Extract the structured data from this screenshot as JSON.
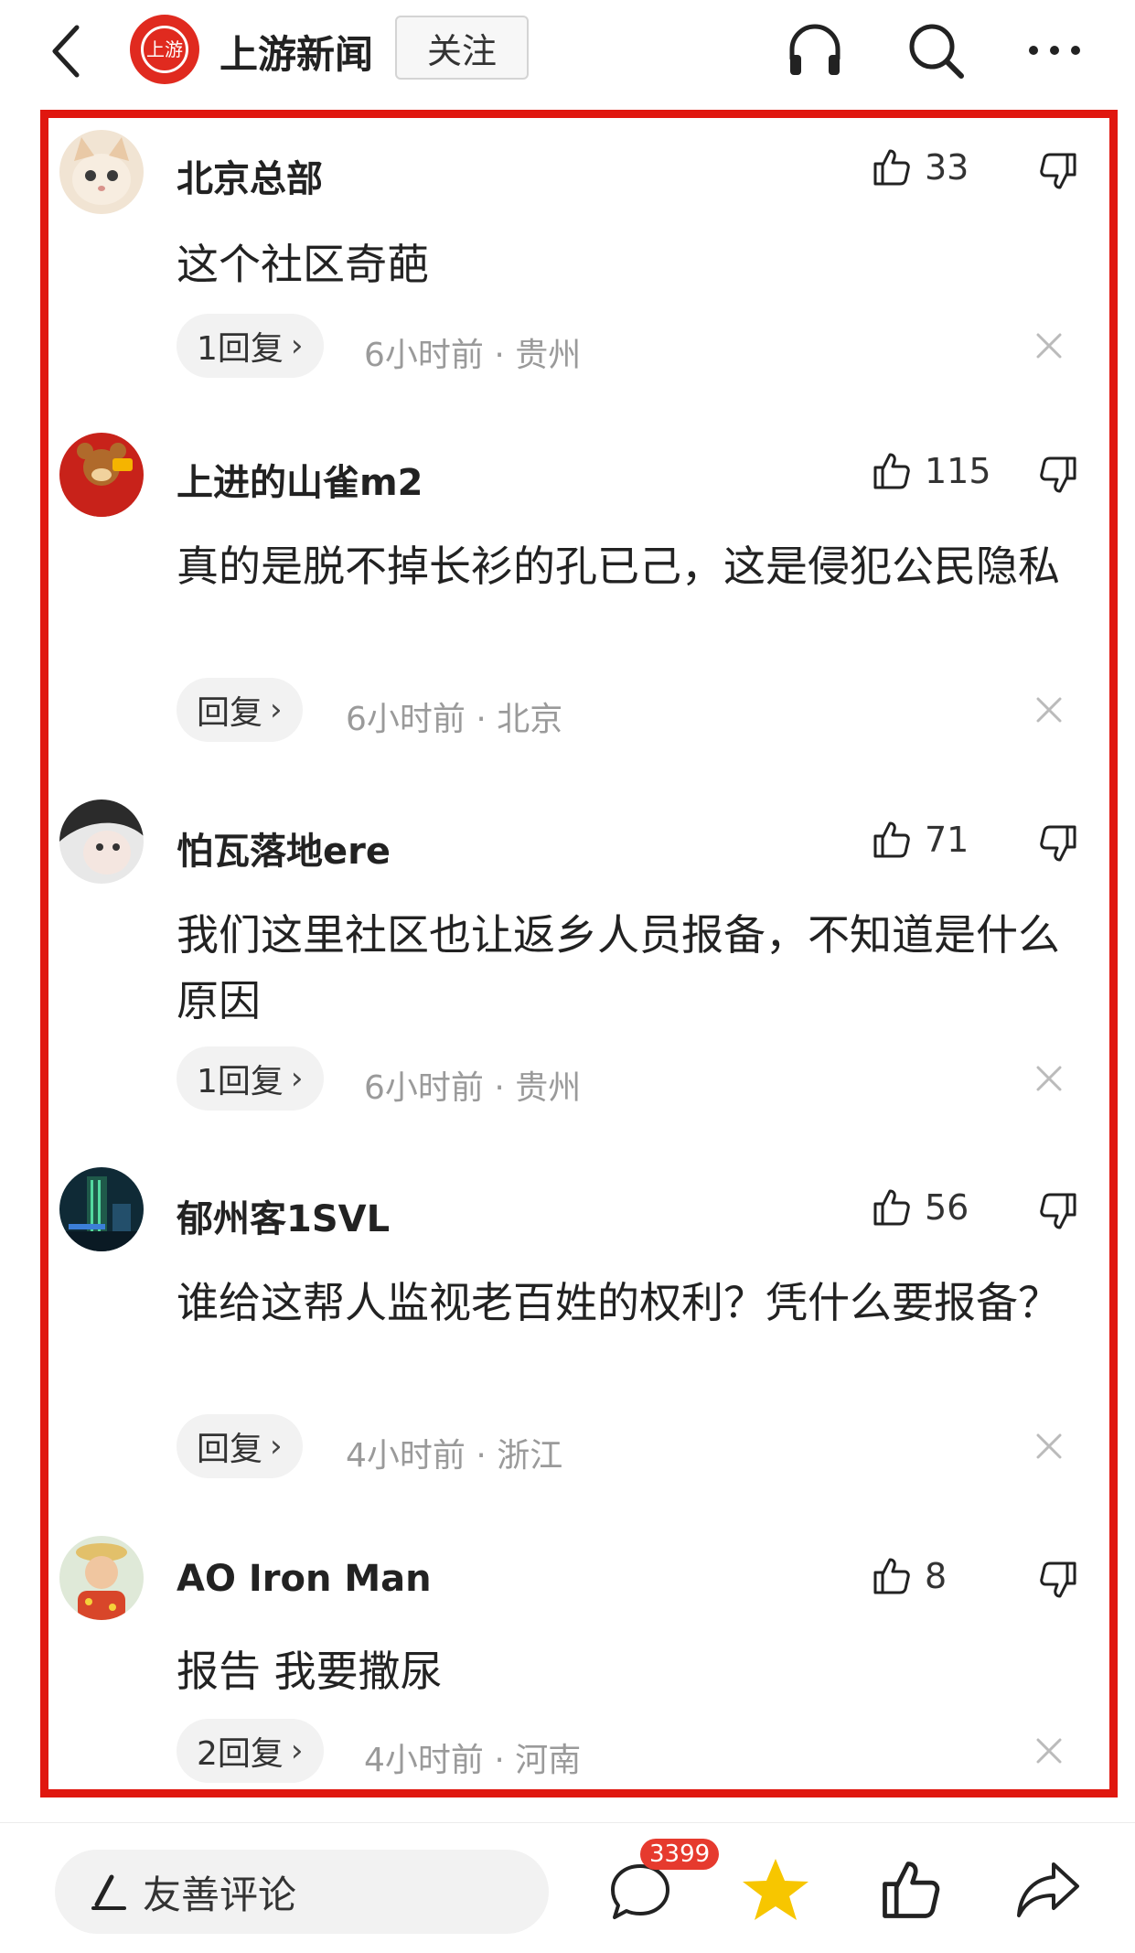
{
  "header": {
    "logo_text": "上游",
    "title": "上游新闻",
    "follow_label": "关注"
  },
  "comments": [
    {
      "username": "北京总部",
      "likes": "33",
      "text": "这个社区奇葩",
      "reply_label": "1回复",
      "time": "6小时前",
      "location": "贵州"
    },
    {
      "username": "上进的山雀m2",
      "likes": "115",
      "text": "真的是脱不掉长衫的孔已己，这是侵犯公民隐私",
      "reply_label": "回复",
      "time": "6小时前",
      "location": "北京"
    },
    {
      "username": "怕瓦落地ere",
      "likes": "71",
      "text": "我们这里社区也让返乡人员报备，不知道是什么原因",
      "reply_label": "1回复",
      "time": "6小时前",
      "location": "贵州"
    },
    {
      "username": "郁州客1SVL",
      "likes": "56",
      "text": "谁给这帮人监视老百姓的权利？凭什么要报备？",
      "reply_label": "回复",
      "time": "4小时前",
      "location": "浙江"
    },
    {
      "username": "AO  Iron Man",
      "likes": "8",
      "text": "报告 我要撒尿",
      "reply_label": "2回复",
      "time": "4小时前",
      "location": "河南"
    }
  ],
  "bottom_bar": {
    "input_placeholder": "友善评论",
    "comment_count": "3399"
  },
  "colors": {
    "frame": "#e0170f",
    "brand": "#e02a1f",
    "badge": "#e63a2e",
    "star": "#f7c600"
  },
  "icons": [
    "back-icon",
    "headphone-icon",
    "search-icon",
    "more-icon",
    "thumbs-up-icon",
    "thumbs-down-icon",
    "close-icon",
    "pen-icon",
    "comment-bubble-icon",
    "star-icon",
    "share-icon"
  ]
}
